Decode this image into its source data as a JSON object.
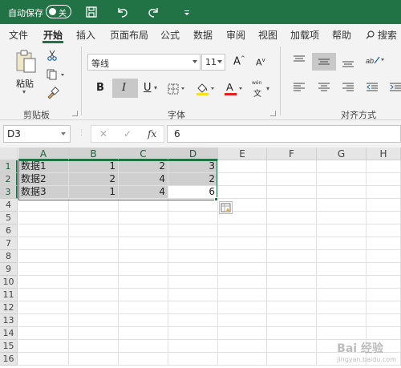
{
  "titlebar": {
    "autosave_label": "自动保存",
    "toggle_state": "关"
  },
  "menu": {
    "tabs": [
      "文件",
      "开始",
      "插入",
      "页面布局",
      "公式",
      "数据",
      "审阅",
      "视图",
      "加载项",
      "帮助"
    ],
    "active_tab": "开始",
    "search_label": "搜索"
  },
  "ribbon": {
    "clipboard": {
      "paste_label": "粘贴",
      "group_label": "剪贴板"
    },
    "font": {
      "font_name": "等线",
      "font_size": "11",
      "group_label": "字体",
      "bold": "B",
      "italic": "I",
      "underline": "U",
      "increase_size": "A",
      "decrease_size": "A",
      "wen_label": "wén",
      "wen_char": "文"
    },
    "alignment": {
      "group_label": "对齐方式"
    }
  },
  "formula_bar": {
    "name_box": "D3",
    "cancel": "✕",
    "enter": "✓",
    "fx": "fx",
    "value": "6"
  },
  "sheet": {
    "columns": [
      "A",
      "B",
      "C",
      "D",
      "E",
      "F",
      "G",
      "H"
    ],
    "rows": [
      "1",
      "2",
      "3",
      "4",
      "5",
      "6",
      "7",
      "8",
      "9",
      "10",
      "11",
      "12",
      "13",
      "14",
      "15",
      "16"
    ],
    "data": [
      [
        "数据1",
        "1",
        "2",
        "3"
      ],
      [
        "数据2",
        "2",
        "4",
        "2"
      ],
      [
        "数据3",
        "1",
        "4",
        "6"
      ]
    ],
    "active_cell": "D3"
  },
  "watermark": {
    "text": "Bai 经验",
    "sub": "jingyan.baidu.com"
  },
  "colors": {
    "accent": "#217346",
    "ribbon_bg": "#f3f3f3",
    "highlight": "#cfcfcf"
  }
}
